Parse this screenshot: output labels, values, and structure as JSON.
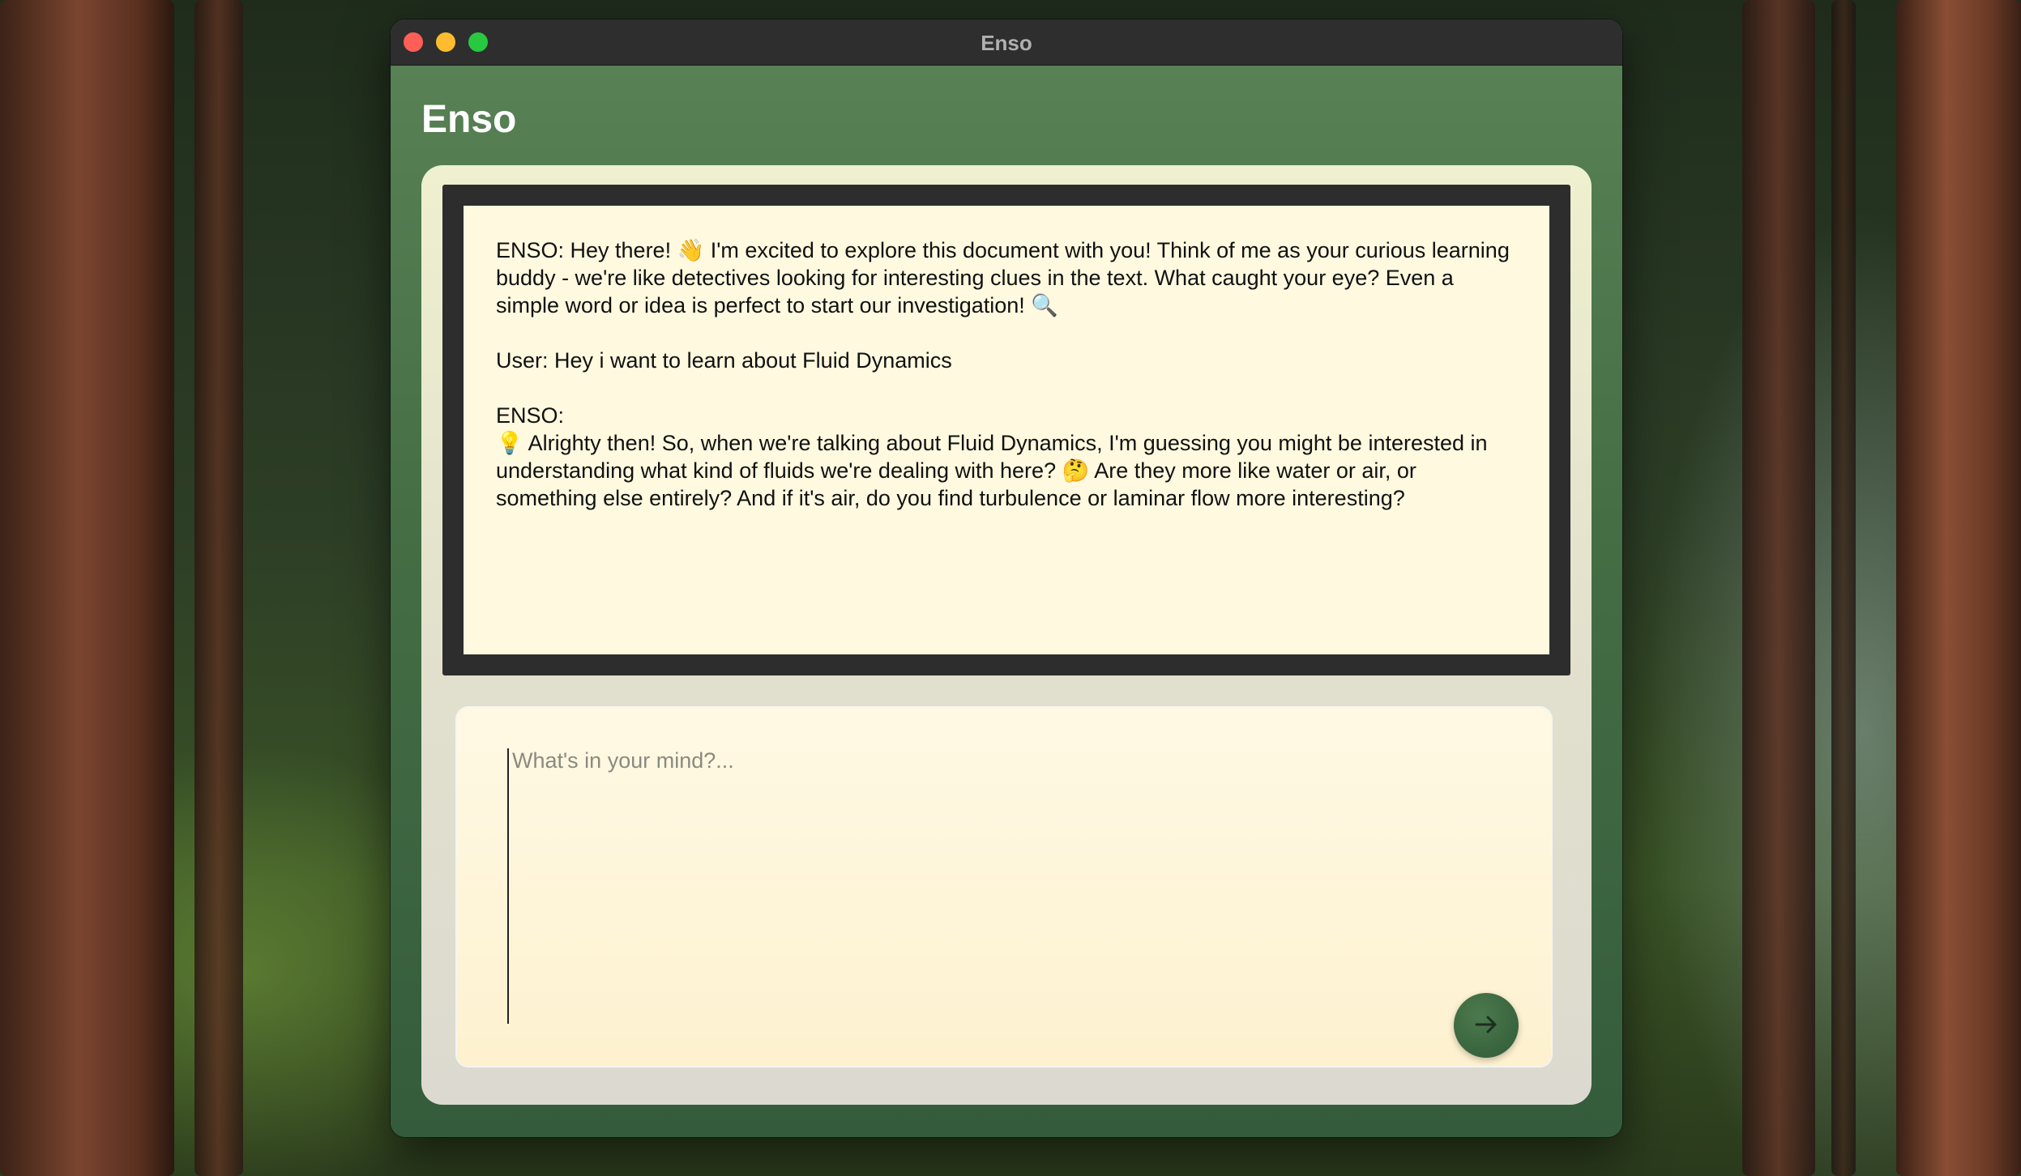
{
  "window": {
    "title": "Enso"
  },
  "app": {
    "title": "Enso"
  },
  "chat": {
    "messages": [
      "ENSO: Hey there! 👋 I'm excited to explore this document with you! Think of me as your curious learning buddy - we're like detectives looking for interesting clues in the text. What caught your eye? Even a simple word or idea is perfect to start our investigation! 🔍",
      "User: Hey i want to learn about Fluid Dynamics",
      "ENSO:\n💡 Alrighty then! So, when we're talking about Fluid Dynamics, I'm guessing you might be interested in understanding what kind of fluids we're dealing with here? 🤔 Are they more like water or air, or something else entirely? And if it's air, do you find turbulence or laminar flow more interesting?"
    ]
  },
  "composer": {
    "placeholder": "What's in your mind?...",
    "value": ""
  },
  "icons": {
    "send": "arrow-right-icon"
  },
  "colors": {
    "window_green": "#4a744a",
    "chat_background": "#fef9df",
    "send_button": "#3a6440"
  }
}
